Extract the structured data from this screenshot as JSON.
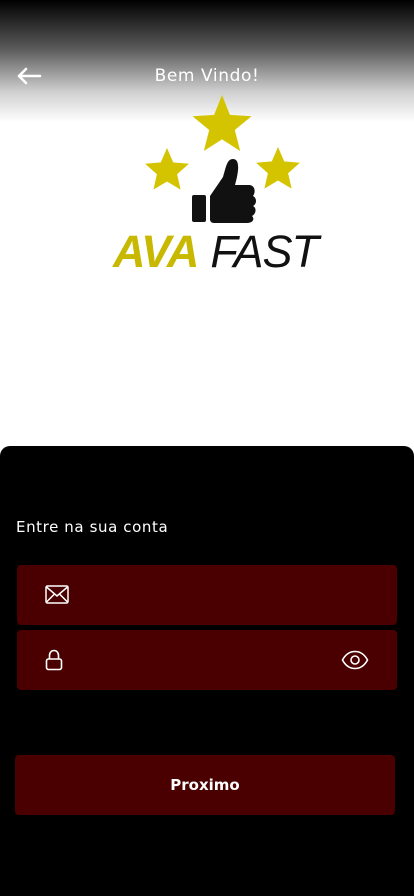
{
  "header": {
    "title": "Bem Vindo!",
    "back_icon": "arrow-left-icon"
  },
  "logo": {
    "brand_part1": "AVA",
    "brand_part2": "FAST",
    "icons": [
      "star-icon",
      "thumbs-up-icon"
    ],
    "colors": {
      "star": "#d4c400",
      "brand": "#c9b800",
      "text": "#111111"
    }
  },
  "login": {
    "prompt": "Entre na sua conta",
    "email": {
      "icon": "envelope-icon",
      "value": "",
      "placeholder": ""
    },
    "password": {
      "icon": "lock-icon",
      "toggle_icon": "eye-icon",
      "value": "",
      "placeholder": ""
    },
    "submit_label": "Proximo"
  },
  "colors": {
    "panel_bg": "#000000",
    "field_bg": "#4a0000",
    "button_bg": "#4a0000",
    "text": "#ffffff"
  }
}
